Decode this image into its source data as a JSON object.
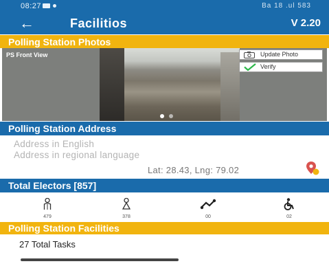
{
  "status_bar": {
    "time": "08:27",
    "right_text": "Ba 18  .ul 583"
  },
  "app_bar": {
    "back_icon": "arrow-left-icon",
    "title": "Facilitios",
    "version": "V 2.20"
  },
  "photos": {
    "header": "Polling Station Photos",
    "view_label": "PS Front View",
    "update_label": "Update Photo",
    "verify_label": "Verify"
  },
  "address": {
    "header": "Polling Station Address",
    "english_placeholder": "Address in English",
    "regional_placeholder": "Address in regional language",
    "lat_lng": "Lat: 28.43, Lng: 79.02"
  },
  "electors": {
    "header": "Total Electors [857]",
    "items": [
      {
        "icon": "male-voter-icon",
        "value": "479"
      },
      {
        "icon": "female-voter-icon",
        "value": "378"
      },
      {
        "icon": "third-gender-icon",
        "value": "00"
      },
      {
        "icon": "pwd-wheelchair-icon",
        "value": "02"
      }
    ]
  },
  "facilities": {
    "header": "Polling Station Facilities",
    "tasks_label": "27 Total Tasks"
  },
  "colors": {
    "primary": "#1a6bab",
    "accent": "#f1b40f",
    "verify_green": "#2db84a",
    "pin_red": "#d9534f"
  }
}
